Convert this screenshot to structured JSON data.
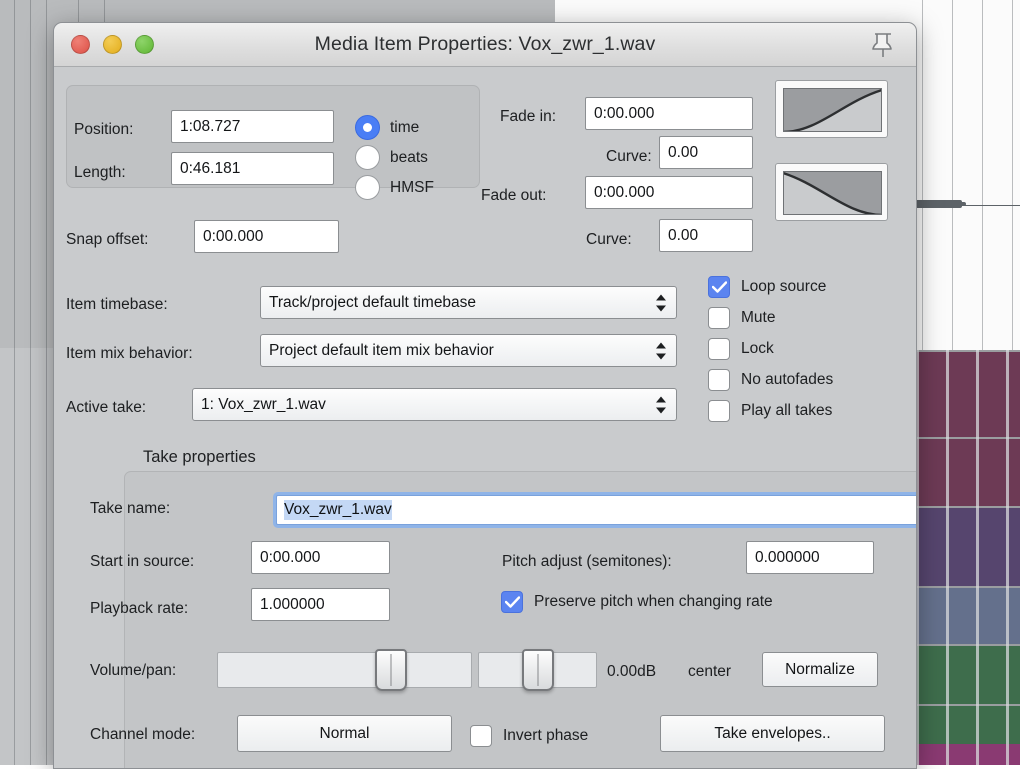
{
  "window": {
    "title": "Media Item Properties:  Vox_zwr_1.wav",
    "pin_icon": "pushpin-icon",
    "close_icon": "close-traffic-light",
    "minimize_icon": "minimize-traffic-light",
    "zoom_icon": "zoom-traffic-light"
  },
  "item": {
    "position_label": "Position:",
    "position_value": "1:08.727",
    "length_label": "Length:",
    "length_value": "0:46.181",
    "snap_offset_label": "Snap offset:",
    "snap_offset_value": "0:00.000",
    "timebase_radios": [
      {
        "label": "time",
        "checked": true
      },
      {
        "label": "beats",
        "checked": false
      },
      {
        "label": "HMSF",
        "checked": false
      }
    ]
  },
  "fades": {
    "fade_in_label": "Fade in:",
    "fade_in_value": "0:00.000",
    "fade_in_curve_label": "Curve:",
    "fade_in_curve_value": "0.00",
    "fade_out_label": "Fade out:",
    "fade_out_value": "0:00.000",
    "fade_out_curve_label": "Curve:",
    "fade_out_curve_value": "0.00",
    "fade_in_shape_icon": "fade-in-curve-icon",
    "fade_out_shape_icon": "fade-out-curve-icon"
  },
  "selectors": {
    "timebase_label": "Item timebase:",
    "timebase_value": "Track/project default timebase",
    "mix_behavior_label": "Item mix behavior:",
    "mix_behavior_value": "Project default item mix behavior",
    "active_take_label": "Active take:",
    "active_take_value": "1: Vox_zwr_1.wav"
  },
  "checkboxes": [
    {
      "label": "Loop source",
      "checked": true
    },
    {
      "label": "Mute",
      "checked": false
    },
    {
      "label": "Lock",
      "checked": false
    },
    {
      "label": "No autofades",
      "checked": false
    },
    {
      "label": "Play all takes",
      "checked": false
    }
  ],
  "take": {
    "legend": "Take properties",
    "name_label": "Take name:",
    "name_value": "Vox_zwr_1.wav",
    "start_in_source_label": "Start in source:",
    "start_in_source_value": "0:00.000",
    "playback_rate_label": "Playback rate:",
    "playback_rate_value": "1.000000",
    "pitch_adjust_label": "Pitch adjust (semitones):",
    "pitch_adjust_value": "0.000000",
    "preserve_pitch_label": "Preserve pitch when changing rate",
    "preserve_pitch_checked": true,
    "volume_pan_label": "Volume/pan:",
    "volume_db": "0.00dB",
    "pan_value": "center",
    "normalize_label": "Normalize",
    "channel_mode_label": "Channel mode:",
    "channel_mode_value": "Normal",
    "invert_phase_label": "Invert phase",
    "invert_phase_checked": false,
    "take_envelopes_label": "Take envelopes.."
  },
  "colors": {
    "accent_blue": "#5b84f0",
    "radio_blue": "#4a7ef5",
    "selection_blue": "#c4d8f5",
    "dialog_bg": "#c9cbcd",
    "track_maroon": "#6d3a55",
    "track_purple": "#56456e",
    "track_slate": "#64708c",
    "track_green": "#3e6d4c",
    "track_magenta": "#8a3a72"
  }
}
